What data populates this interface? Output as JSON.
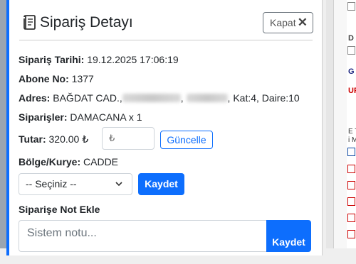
{
  "modal": {
    "title": "Sipariş Detayı",
    "close_label": "Kapat",
    "close_symbol": "✕",
    "order_date_label": "Sipariş Tarihi:",
    "order_date_value": "19.12.2025 17:06:19",
    "subscriber_label": "Abone No:",
    "subscriber_value": "1377",
    "address_label": "Adres:",
    "address_start": "BAĞDAT CAD.,",
    "address_end": ", Kat:4, Daire:10",
    "orders_label": "Siparişler:",
    "orders_value": "DAMACANA x 1",
    "amount_label": "Tutar:",
    "amount_value": "320.00 ₺",
    "amount_input_placeholder": "₺",
    "update_label": "Güncelle",
    "region_label": "Bölge/Kurye:",
    "region_value": "CADDE",
    "select_value": "-- Seçiniz --",
    "save_label": "Kaydet",
    "note_heading": "Siparişe Not Ekle",
    "note_placeholder": "Sistem notu...",
    "note_save_label": "Kaydet"
  },
  "background_strip": [
    "D",
    "G",
    "UF",
    "E T",
    "i M"
  ],
  "colors": {
    "accent": "#0d6efd",
    "danger_strip": "#cc0000"
  }
}
